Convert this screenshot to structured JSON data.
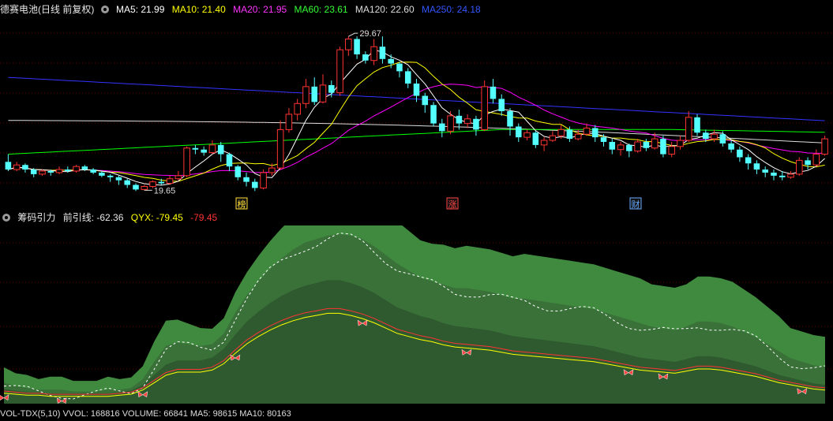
{
  "header": {
    "stock_title": "德赛电池(日线 前复权)",
    "ma5": "MA5: 21.99",
    "ma10": "MA10: 21.40",
    "ma20": "MA20: 21.95",
    "ma60": "MA60: 23.61",
    "ma120": "MA120: 22.60",
    "ma250": "MA250: 24.18"
  },
  "indicator_header": {
    "name": "筹码引力",
    "qian": "前引线: -62.36",
    "qyx": "QYX: -79.45",
    "extra": "-79.45"
  },
  "volume_header": {
    "text": "VOL-TDX(5,10)  VVOL: 168816  VOLUME: 66841  MA5: 98615  MA10: 80163"
  },
  "colors": {
    "ma5": "#ffffff",
    "ma10": "#ffff00",
    "ma20": "#ff00ff",
    "ma60": "#00ff00",
    "ma120": "#dddddd",
    "ma250": "#3333ff",
    "up": "#ff3333",
    "down": "#54ffff",
    "band_outer": "#3f8a3f",
    "band_mid": "#397139",
    "band_inner": "#2f5a2f"
  },
  "chart_data": [
    {
      "type": "candlestick",
      "title": "德赛电池(日线 前复权)",
      "annotations": {
        "high_label": "29.67",
        "low_label": "19.65",
        "markers": [
          "榜",
          "涨",
          "财"
        ]
      },
      "ylim": [
        19,
        30.5
      ],
      "candles": [
        [
          21.5,
          21.0,
          22.0,
          20.9
        ],
        [
          21.0,
          21.3,
          21.5,
          20.9
        ],
        [
          21.3,
          21.0,
          21.4,
          20.8
        ],
        [
          21.0,
          20.7,
          21.1,
          20.5
        ],
        [
          20.7,
          20.9,
          21.0,
          20.6
        ],
        [
          20.9,
          20.8,
          21.0,
          20.6
        ],
        [
          20.8,
          21.0,
          21.2,
          20.7
        ],
        [
          21.0,
          20.9,
          21.2,
          20.8
        ],
        [
          20.9,
          21.2,
          21.3,
          20.8
        ],
        [
          21.2,
          21.0,
          21.3,
          20.9
        ],
        [
          21.0,
          20.8,
          21.1,
          20.7
        ],
        [
          20.8,
          20.6,
          20.9,
          20.5
        ],
        [
          20.6,
          20.5,
          20.7,
          20.2
        ],
        [
          20.5,
          20.3,
          20.6,
          20.0
        ],
        [
          20.3,
          20.0,
          20.4,
          19.8
        ],
        [
          20.0,
          19.7,
          20.1,
          19.6
        ],
        [
          19.7,
          19.9,
          20.0,
          19.65
        ],
        [
          19.9,
          20.2,
          20.3,
          19.8
        ],
        [
          20.2,
          20.1,
          20.4,
          20.0
        ],
        [
          20.1,
          20.4,
          20.6,
          20.0
        ],
        [
          20.4,
          20.6,
          20.9,
          20.3
        ],
        [
          20.6,
          22.4,
          22.5,
          20.5
        ],
        [
          22.4,
          22.3,
          22.6,
          22.0
        ],
        [
          22.3,
          22.1,
          22.5,
          21.9
        ],
        [
          22.1,
          22.6,
          22.9,
          22.0
        ],
        [
          22.6,
          22.0,
          22.8,
          21.5
        ],
        [
          22.0,
          21.2,
          22.1,
          20.9
        ],
        [
          21.2,
          20.5,
          21.3,
          20.3
        ],
        [
          20.5,
          20.2,
          20.8,
          19.9
        ],
        [
          20.2,
          19.8,
          20.4,
          19.6
        ],
        [
          19.8,
          20.8,
          21.0,
          19.7
        ],
        [
          20.8,
          21.1,
          21.4,
          20.6
        ],
        [
          21.1,
          23.6,
          24.2,
          21.0
        ],
        [
          23.6,
          24.6,
          25.0,
          23.4
        ],
        [
          24.6,
          25.3,
          25.6,
          24.2
        ],
        [
          25.3,
          26.4,
          26.9,
          25.0
        ],
        [
          26.4,
          25.4,
          27.0,
          25.2
        ],
        [
          25.4,
          26.5,
          27.2,
          25.3
        ],
        [
          26.5,
          26.0,
          26.8,
          25.7
        ],
        [
          26.0,
          28.8,
          29.0,
          25.8
        ],
        [
          28.8,
          29.5,
          29.67,
          28.4
        ],
        [
          29.5,
          28.5,
          29.67,
          28.2
        ],
        [
          28.5,
          28.1,
          28.7,
          27.9
        ],
        [
          28.1,
          29.0,
          29.5,
          27.8
        ],
        [
          29.0,
          28.2,
          29.67,
          27.9
        ],
        [
          28.2,
          27.9,
          28.5,
          27.6
        ],
        [
          27.9,
          27.4,
          28.0,
          27.0
        ],
        [
          27.4,
          26.6,
          27.6,
          26.3
        ],
        [
          26.6,
          25.8,
          26.9,
          25.4
        ],
        [
          25.8,
          25.2,
          26.0,
          24.7
        ],
        [
          25.2,
          24.0,
          25.4,
          23.8
        ],
        [
          24.0,
          23.5,
          24.3,
          23.1
        ],
        [
          23.5,
          24.5,
          24.8,
          23.3
        ],
        [
          24.5,
          24.0,
          24.9,
          23.6
        ],
        [
          24.0,
          24.3,
          24.6,
          23.7
        ],
        [
          24.3,
          23.6,
          24.5,
          23.2
        ],
        [
          23.6,
          26.4,
          26.8,
          23.5
        ],
        [
          26.4,
          25.6,
          26.9,
          25.3
        ],
        [
          25.6,
          24.8,
          25.9,
          24.5
        ],
        [
          24.8,
          23.8,
          25.0,
          23.2
        ],
        [
          23.8,
          23.1,
          24.0,
          22.8
        ],
        [
          23.1,
          23.4,
          23.6,
          22.9
        ],
        [
          23.4,
          22.6,
          23.5,
          22.4
        ],
        [
          22.6,
          22.9,
          23.1,
          22.2
        ],
        [
          22.9,
          23.2,
          23.5,
          22.8
        ],
        [
          23.2,
          23.6,
          23.9,
          23.0
        ],
        [
          23.6,
          23.0,
          23.8,
          22.8
        ],
        [
          23.0,
          23.3,
          23.6,
          22.9
        ],
        [
          23.3,
          23.7,
          24.0,
          23.2
        ],
        [
          23.7,
          23.1,
          23.9,
          22.8
        ],
        [
          23.1,
          22.8,
          23.3,
          22.5
        ],
        [
          22.8,
          22.3,
          23.0,
          22.0
        ],
        [
          22.3,
          22.6,
          22.8,
          21.9
        ],
        [
          22.6,
          22.2,
          22.7,
          21.8
        ],
        [
          22.2,
          22.8,
          23.0,
          22.1
        ],
        [
          22.8,
          22.4,
          23.0,
          22.2
        ],
        [
          22.4,
          23.0,
          23.4,
          22.3
        ],
        [
          23.0,
          22.0,
          23.2,
          21.8
        ],
        [
          22.0,
          22.5,
          22.8,
          21.8
        ],
        [
          22.5,
          22.9,
          23.2,
          22.3
        ],
        [
          22.9,
          24.4,
          24.8,
          22.8
        ],
        [
          24.4,
          23.4,
          24.6,
          23.2
        ],
        [
          23.4,
          23.0,
          23.6,
          22.8
        ],
        [
          23.0,
          23.3,
          23.6,
          22.8
        ],
        [
          23.3,
          22.7,
          23.5,
          22.5
        ],
        [
          22.7,
          22.3,
          22.9,
          22.1
        ],
        [
          22.3,
          21.8,
          22.5,
          21.5
        ],
        [
          21.8,
          21.4,
          22.0,
          21.0
        ],
        [
          21.4,
          21.0,
          21.6,
          20.7
        ],
        [
          21.0,
          20.8,
          21.2,
          20.5
        ],
        [
          20.8,
          20.6,
          21.0,
          20.3
        ],
        [
          20.6,
          20.5,
          20.9,
          20.3
        ],
        [
          20.5,
          20.7,
          20.9,
          20.4
        ],
        [
          20.7,
          21.6,
          21.8,
          20.6
        ],
        [
          21.6,
          21.3,
          21.8,
          21.0
        ],
        [
          21.3,
          22.0,
          22.3,
          21.2
        ],
        [
          22.0,
          23.0,
          23.2,
          21.9
        ]
      ]
    },
    {
      "type": "area",
      "title": "筹码引力",
      "ylim": [
        0,
        100
      ],
      "series": [
        {
          "name": "前引线",
          "values": [
            12,
            10,
            9,
            8,
            8,
            8,
            7,
            7,
            7,
            8,
            8,
            9,
            14,
            24,
            33,
            35,
            34,
            33,
            34,
            40,
            52,
            62,
            70,
            77,
            83,
            88,
            92,
            94,
            96,
            97,
            96,
            94,
            90,
            85,
            80,
            76,
            72,
            70,
            68,
            66,
            66,
            65,
            64,
            62,
            60,
            60,
            59,
            58,
            57,
            56,
            55,
            54,
            52,
            50,
            48,
            46,
            44,
            43,
            42,
            44,
            47,
            47,
            46,
            44,
            41,
            38,
            34,
            30,
            26,
            24,
            22,
            21
          ]
        },
        {
          "name": "QYX",
          "values": [
            10,
            9,
            8,
            8,
            7,
            7,
            7,
            7,
            7,
            7,
            8,
            9,
            13,
            20,
            27,
            30,
            30,
            30,
            32,
            38,
            48,
            57,
            64,
            70,
            75,
            79,
            82,
            84,
            86,
            86,
            84,
            81,
            77,
            72,
            67,
            64,
            61,
            59,
            56,
            54,
            53,
            52,
            51,
            49,
            47,
            46,
            45,
            44,
            43,
            42,
            41,
            40,
            38,
            36,
            34,
            32,
            31,
            30,
            29,
            31,
            33,
            33,
            32,
            30,
            28,
            26,
            23,
            20,
            18,
            16,
            14,
            13
          ]
        }
      ]
    }
  ]
}
